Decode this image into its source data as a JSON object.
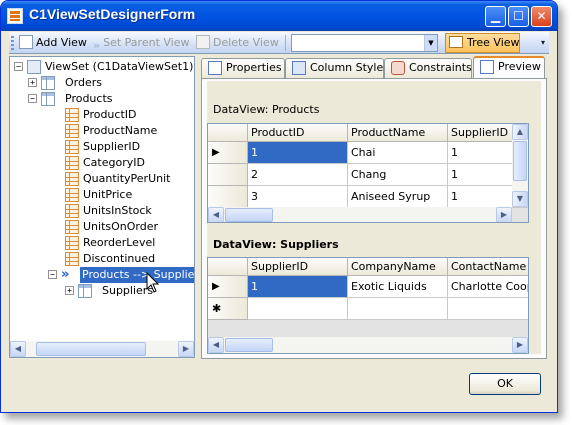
{
  "window": {
    "title": "C1ViewSetDesignerForm"
  },
  "toolbar": {
    "add_view": "Add View",
    "set_parent_view": "Set Parent View",
    "delete_view": "Delete View",
    "combo_value": "",
    "tree_view": "Tree View"
  },
  "tree": {
    "root": "ViewSet (C1DataViewSet1)",
    "orders": "Orders",
    "products": "Products",
    "columns": [
      "ProductID",
      "ProductName",
      "SupplierID",
      "CategoryID",
      "QuantityPerUnit",
      "UnitPrice",
      "UnitsInStock",
      "UnitsOnOrder",
      "ReorderLevel",
      "Discontinued"
    ],
    "relation": "Products --> Suppliers",
    "suppliers": "Suppliers"
  },
  "tabs": [
    {
      "label": "Properties",
      "icon": "properties-icon"
    },
    {
      "label": "Column Styles",
      "icon": "column-styles-icon"
    },
    {
      "label": "Constraints",
      "icon": "constraints-icon"
    },
    {
      "label": "Preview",
      "icon": "preview-icon",
      "active": true
    }
  ],
  "preview": {
    "products_label": "DataView:  Products",
    "products_columns": [
      "ProductID",
      "ProductName",
      "SupplierID"
    ],
    "products_rows": [
      [
        "1",
        "Chai",
        "1"
      ],
      [
        "2",
        "Chang",
        "1"
      ],
      [
        "3",
        "Aniseed Syrup",
        "1"
      ]
    ],
    "suppliers_label": "DataView:  Suppliers",
    "suppliers_columns": [
      "SupplierID",
      "CompanyName",
      "ContactName"
    ],
    "suppliers_rows": [
      [
        "1",
        "Exotic Liquids",
        "Charlotte Cooper"
      ]
    ],
    "current_row_marker": "▶",
    "new_row_marker": "✱"
  },
  "buttons": {
    "ok": "OK"
  },
  "colors": {
    "selection": "#316ac5",
    "title_bar": "#0054e3",
    "tab_highlight": "#e68b2c"
  }
}
